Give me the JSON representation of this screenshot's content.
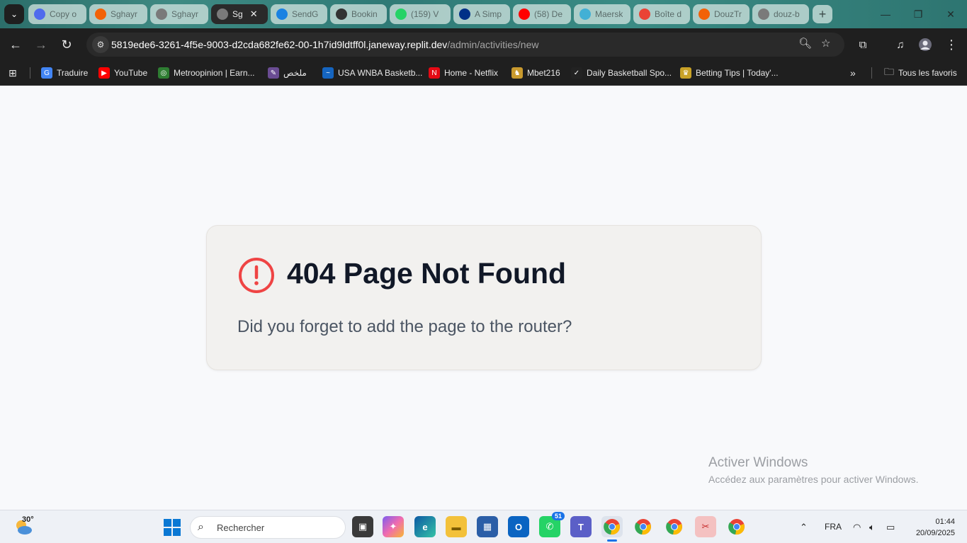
{
  "browser": {
    "tabs": [
      {
        "label": "Copy o",
        "fav_color": "#4f6bed",
        "active": false
      },
      {
        "label": "Sghayr",
        "fav_color": "#f26207",
        "active": false
      },
      {
        "label": "Sghayr",
        "fav_color": "#7a7a7a",
        "active": false
      },
      {
        "label": "Sg",
        "fav_color": "#7a7a7a",
        "active": true
      },
      {
        "label": "SendG",
        "fav_color": "#1a82e2",
        "active": false
      },
      {
        "label": "Bookin",
        "fav_color": "#333333",
        "active": false
      },
      {
        "label": "(159) V",
        "fav_color": "#25d366",
        "active": false
      },
      {
        "label": "A Simp",
        "fav_color": "#003087",
        "active": false
      },
      {
        "label": "(58) De",
        "fav_color": "#ff0000",
        "active": false
      },
      {
        "label": "Maersk",
        "fav_color": "#42b0d5",
        "active": false
      },
      {
        "label": "Boîte d",
        "fav_color": "#ea4335",
        "active": false
      },
      {
        "label": "DouzTr",
        "fav_color": "#f26207",
        "active": false
      },
      {
        "label": "douz-b",
        "fav_color": "#7a7a7a",
        "active": false
      }
    ],
    "new_tab_label": "+",
    "url_host": "5819ede6-3261-4f5e-9003-d2cda682fe62-00-1h7id9ldtff0l.janeway.replit.dev",
    "url_path": "/admin/activities/new",
    "bookmarks": [
      {
        "label": "Traduire",
        "fav_color": "#4285f4",
        "glyph": "G"
      },
      {
        "label": "YouTube",
        "fav_color": "#ff0000",
        "glyph": "▶"
      },
      {
        "label": "Metroopinion | Earn...",
        "fav_color": "#2e7d32",
        "glyph": "◎"
      },
      {
        "label": "ملخص",
        "fav_color": "#6a4c93",
        "glyph": "✎"
      },
      {
        "label": "USA WNBA Basketb...",
        "fav_color": "#1565c0",
        "glyph": "~"
      },
      {
        "label": "Home - Netflix",
        "fav_color": "#e50914",
        "glyph": "N"
      },
      {
        "label": "Mbet216",
        "fav_color": "#c99a2e",
        "glyph": "♞"
      },
      {
        "label": "Daily Basketball Spo...",
        "fav_color": "#222222",
        "glyph": "✓"
      },
      {
        "label": "Betting Tips | Today'...",
        "fav_color": "#c9a227",
        "glyph": "♛"
      }
    ],
    "all_bookmarks_label": "Tous les favoris"
  },
  "page": {
    "title": "404 Page Not Found",
    "message": "Did you forget to add the page to the router?",
    "icon": "alert-circle-icon",
    "accent_color": "#ef4444"
  },
  "watermark": {
    "line1": "Activer Windows",
    "line2": "Accédez aux paramètres pour activer Windows."
  },
  "taskbar": {
    "temperature": "30°",
    "search_placeholder": "Rechercher",
    "whatsapp_badge": "51",
    "language": "FRA",
    "time": "01:44",
    "date": "20/09/2025"
  }
}
